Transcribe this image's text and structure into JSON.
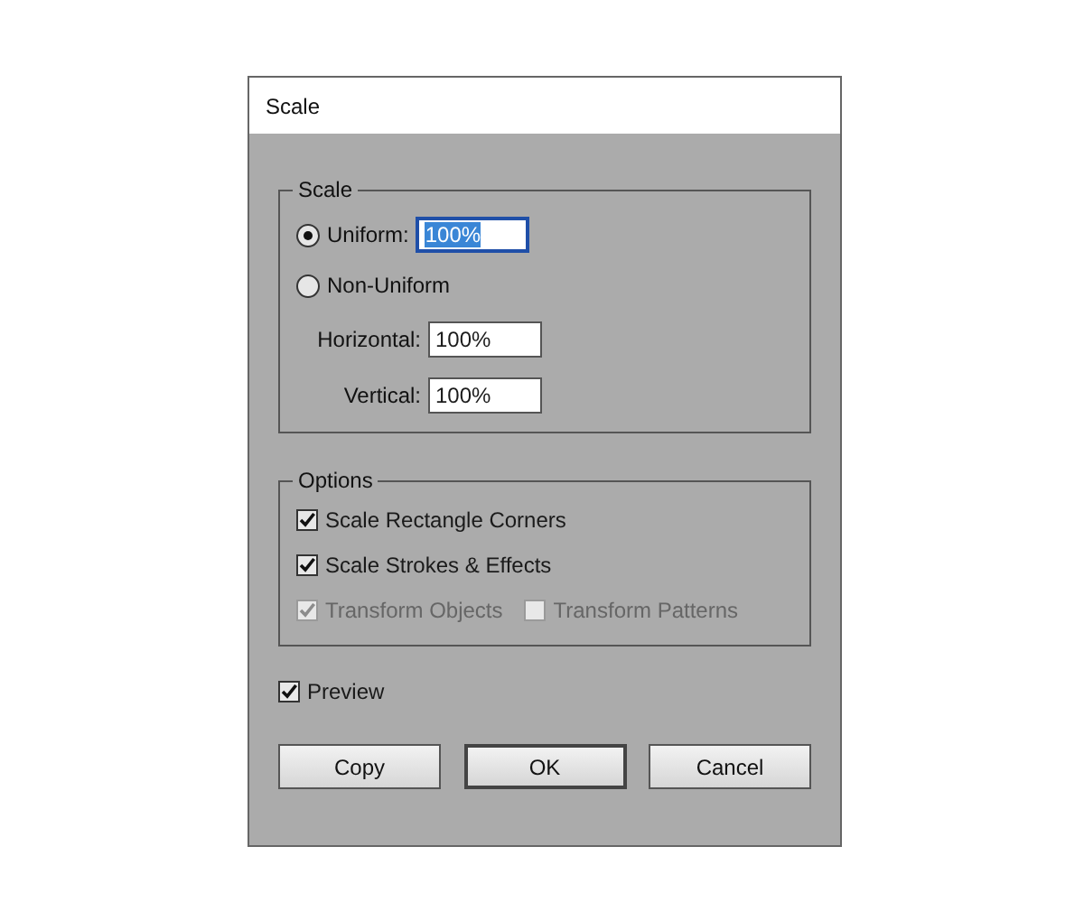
{
  "window": {
    "title": "Scale"
  },
  "scale_group": {
    "legend": "Scale",
    "radios": [
      {
        "label": "Uniform:",
        "selected": true,
        "value": "100%",
        "focused": true
      },
      {
        "label": "Non-Uniform",
        "selected": false
      }
    ],
    "fields": [
      {
        "label": "Horizontal:",
        "value": "100%",
        "focused": false
      },
      {
        "label": "Vertical:",
        "value": "100%",
        "focused": false
      }
    ]
  },
  "options_group": {
    "legend": "Options",
    "rows": [
      [
        {
          "label": "Scale Rectangle Corners",
          "checked": true,
          "disabled": false
        }
      ],
      [
        {
          "label": "Scale Strokes & Effects",
          "checked": true,
          "disabled": false
        }
      ],
      [
        {
          "label": "Transform Objects",
          "checked": true,
          "disabled": true
        },
        {
          "label": "Transform Patterns",
          "checked": false,
          "disabled": true
        }
      ]
    ]
  },
  "preview": {
    "label": "Preview",
    "checked": true,
    "disabled": false
  },
  "buttons": [
    {
      "label": "Copy",
      "default": false
    },
    {
      "label": "OK",
      "default": true
    },
    {
      "label": "Cancel",
      "default": false
    }
  ]
}
